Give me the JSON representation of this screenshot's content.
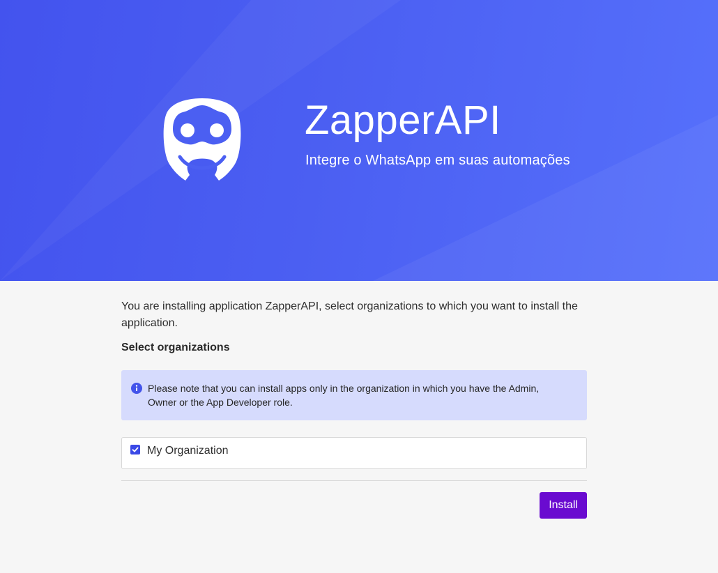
{
  "hero": {
    "title": "ZapperAPI",
    "subtitle": "Integre o WhatsApp em suas automações",
    "logo_icon": "robot-face-icon"
  },
  "install": {
    "intro": "You are installing application ZapperAPI, select organizations to which you want to install the application.",
    "section_title": "Select organizations",
    "notice": {
      "icon": "info-icon",
      "text": "Please note that you can install apps only in the organization in which you have the Admin, Owner or the App Developer role."
    },
    "organizations": [
      {
        "label": "My Organization",
        "checked": true
      }
    ],
    "button_label": "Install"
  },
  "colors": {
    "hero_bg": "#4b5ff2",
    "notice_bg": "#d6dbfd",
    "checkbox": "#3a49e6",
    "button": "#6a0bd0",
    "page_bg": "#f6f6f6"
  }
}
